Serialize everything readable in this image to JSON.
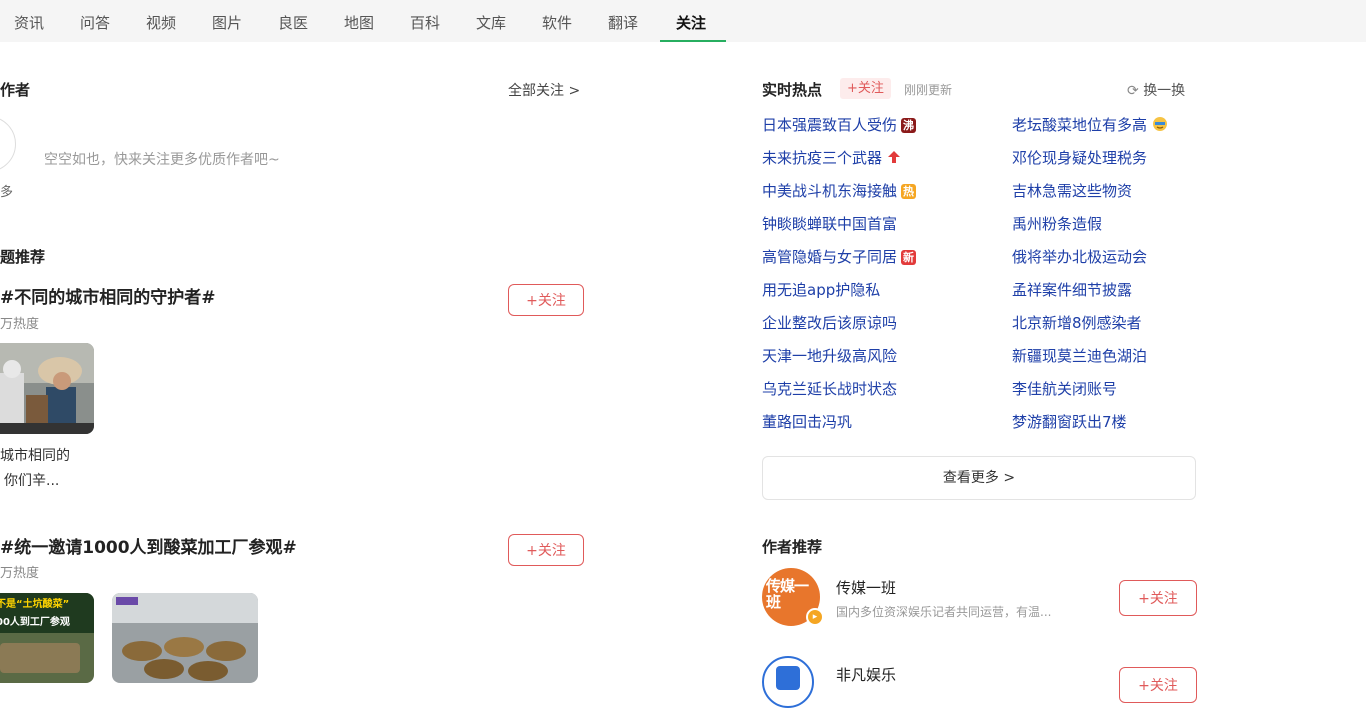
{
  "nav": {
    "tabs": [
      "资讯",
      "问答",
      "视频",
      "图片",
      "良医",
      "地图",
      "百科",
      "文库",
      "软件",
      "翻译",
      "关注"
    ],
    "active": "关注"
  },
  "left": {
    "authors_title": "作者",
    "all_follow": "全部关注 >",
    "empty_text": "空空如也，快来关注更多优质作者吧~",
    "more_fragment": "多",
    "topics_title": "题推荐",
    "topics": [
      {
        "title": "#不同的城市相同的守护者#",
        "heat": "万热度",
        "follow": "+关注",
        "caption_line1": "城市相同的",
        "caption_line2": "你们辛..."
      },
      {
        "title": "#统一邀请1000人到酸菜加工厂参观#",
        "heat": "万热度",
        "follow": "+关注",
        "img_text1": "不是“土坑酸菜”",
        "img_text2": "00人到工厂参观"
      }
    ]
  },
  "hot": {
    "title": "实时热点",
    "follow": "+关注",
    "updated": "刚刚更新",
    "refresh": "换一换",
    "left_items": [
      {
        "text": "日本强震致百人受伤",
        "badge": "沸"
      },
      {
        "text": "未来抗疫三个武器",
        "badge": "up"
      },
      {
        "text": "中美战斗机东海接触",
        "badge": "热"
      },
      {
        "text": "钟睒睒蝉联中国首富",
        "badge": ""
      },
      {
        "text": "高管隐婚与女子同居",
        "badge": "新"
      },
      {
        "text": "用无追app护隐私",
        "badge": ""
      },
      {
        "text": "企业整改后该原谅吗",
        "badge": ""
      },
      {
        "text": "天津一地升级高风险",
        "badge": ""
      },
      {
        "text": "乌克兰延长战时状态",
        "badge": ""
      },
      {
        "text": "董路回击冯巩",
        "badge": ""
      }
    ],
    "right_items": [
      {
        "text": "老坛酸菜地位有多高",
        "badge": "emoji"
      },
      {
        "text": "邓伦现身疑处理税务",
        "badge": ""
      },
      {
        "text": "吉林急需这些物资",
        "badge": ""
      },
      {
        "text": "禹州粉条造假",
        "badge": ""
      },
      {
        "text": "俄将举办北极运动会",
        "badge": ""
      },
      {
        "text": "孟祥案件细节披露",
        "badge": ""
      },
      {
        "text": "北京新增8例感染者",
        "badge": ""
      },
      {
        "text": "新疆现莫兰迪色湖泊",
        "badge": ""
      },
      {
        "text": "李佳航关闭账号",
        "badge": ""
      },
      {
        "text": "梦游翻窗跃出7楼",
        "badge": ""
      }
    ],
    "more": "查看更多 >"
  },
  "authors": {
    "title": "作者推荐",
    "items": [
      {
        "name": "传媒一班",
        "desc": "国内多位资深娱乐记者共同运营，有温...",
        "follow": "+关注",
        "avatar_text": "传媒一班"
      },
      {
        "name": "非凡娱乐",
        "desc": "",
        "follow": "+关注"
      }
    ]
  },
  "colors": {
    "accent_green": "#27ae60",
    "follow_red": "#e05a5a",
    "link_blue": "#1e3fa8"
  }
}
